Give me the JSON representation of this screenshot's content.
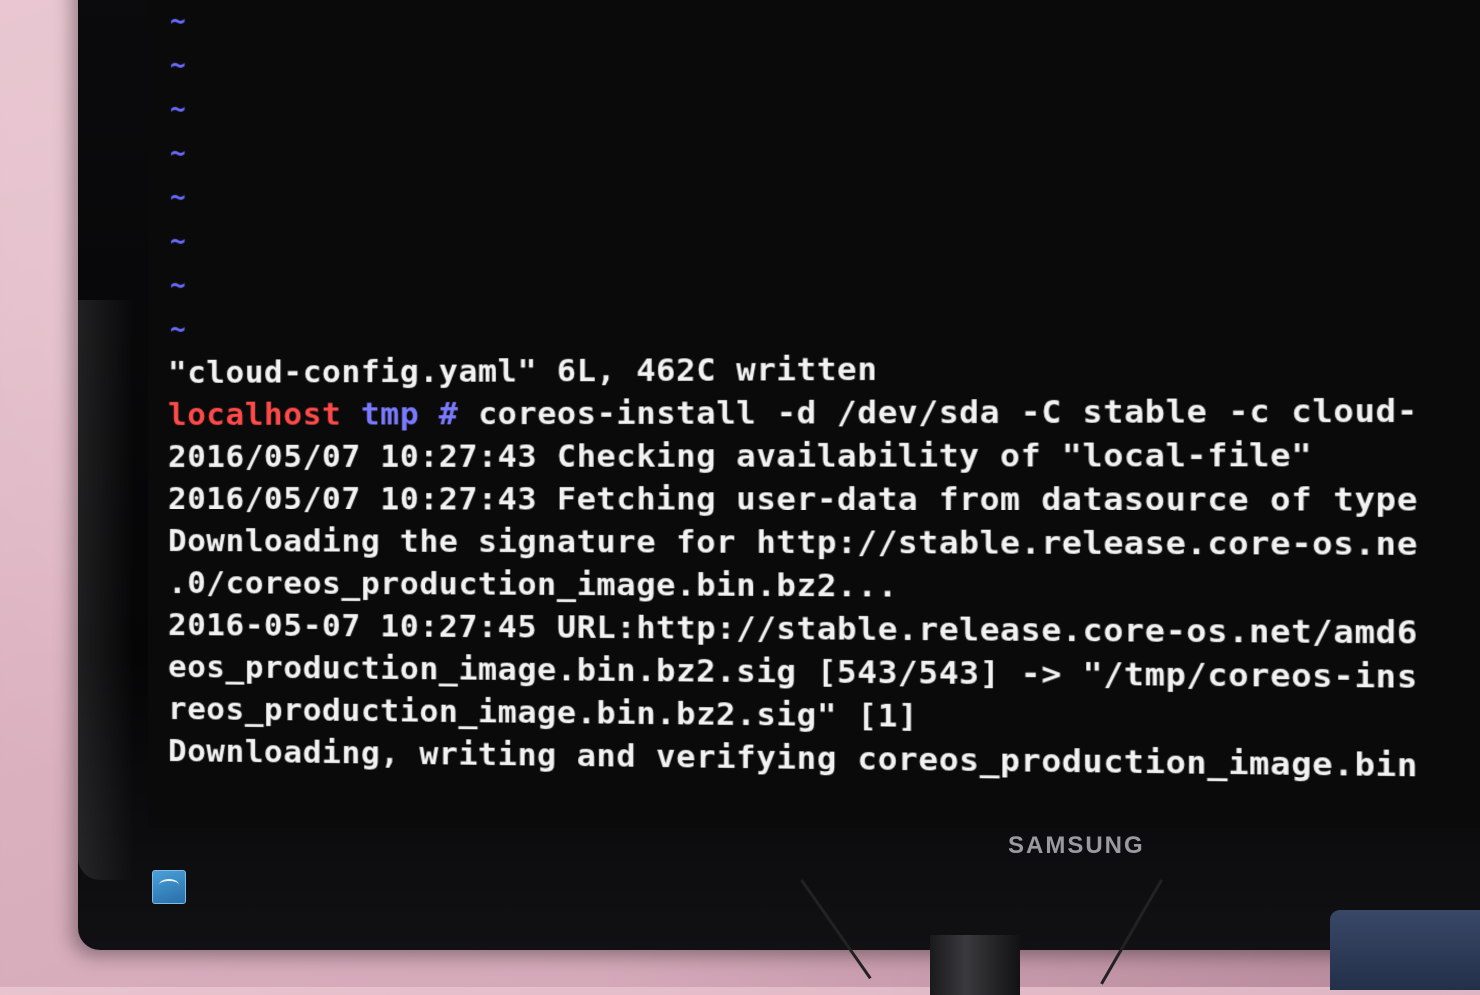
{
  "vim": {
    "tilde_lines": [
      "~",
      "~",
      "~",
      "~",
      "~",
      "~",
      "~",
      "~"
    ],
    "status_message": "\"cloud-config.yaml\" 6L, 462C written"
  },
  "prompt": {
    "host": "localhost",
    "dir": "tmp",
    "symbol": "#",
    "command": "coreos-install -d /dev/sda -C stable -c cloud-"
  },
  "output_lines": [
    "2016/05/07 10:27:43 Checking availability of \"local-file\"",
    "2016/05/07 10:27:43 Fetching user-data from datasource of type",
    "Downloading the signature for http://stable.release.core-os.ne",
    ".0/coreos_production_image.bin.bz2...",
    "2016-05-07 10:27:45 URL:http://stable.release.core-os.net/amd6",
    "eos_production_image.bin.bz2.sig [543/543] -> \"/tmp/coreos-ins",
    "reos_production_image.bin.bz2.sig\" [1]",
    "Downloading, writing and verifying coreos_production_image.bin"
  ],
  "monitor": {
    "brand": "SAMSUNG"
  },
  "colors": {
    "host": "#ff4a4a",
    "dir": "#7a7aff",
    "tilde": "#6a6aff",
    "text": "#f2f2f2",
    "background": "#0a0a0a"
  }
}
